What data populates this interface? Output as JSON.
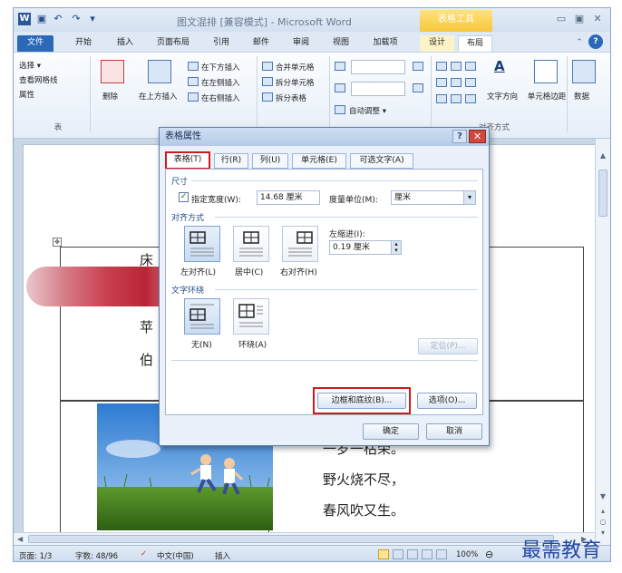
{
  "title_bar": {
    "title": "图文混排 [兼容模式] - Microsoft Word",
    "context_tools": "表格工具",
    "word_icon": "W",
    "qat_icons": [
      "save-icon",
      "undo-icon",
      "redo-icon",
      "customize-icon"
    ],
    "window_buttons": [
      "minimize-icon",
      "restore-icon",
      "close-icon"
    ]
  },
  "tabs": [
    "文件",
    "开始",
    "插入",
    "页面布局",
    "引用",
    "邮件",
    "审阅",
    "视图",
    "加载项",
    "设计",
    "布局"
  ],
  "ribbon": {
    "table_group": {
      "select": "选择 ▾",
      "gridlines": "查看网格线",
      "properties": "属性",
      "name": "表"
    },
    "delete": "删除",
    "insert_above": "在上方插入",
    "insert_below": "在下方插入",
    "insert_left": "在左侧插入",
    "insert_right": "在右侧插入",
    "merge_cells": "合并单元格",
    "split_cells": "拆分单元格",
    "split_table": "拆分表格",
    "autofit": "自动调整 ▾",
    "text_direction": "文字方向",
    "cell_margins": "单元格边距",
    "data": "数据",
    "align_group_name": "对齐方式"
  },
  "dialog": {
    "title": "表格属性",
    "help": "?",
    "close": "✕",
    "tabs": [
      "表格(T)",
      "行(R)",
      "列(U)",
      "单元格(E)",
      "可选文字(A)"
    ],
    "size_section": "尺寸",
    "preferred_width_label": "指定宽度(W):",
    "preferred_width_value": "14.68 厘米",
    "measure_label": "度量单位(M):",
    "measure_value": "厘米",
    "alignment_section": "对齐方式",
    "indent_label": "左缩进(I):",
    "indent_value": "0.19 厘米",
    "align_options": [
      "左对齐(L)",
      "居中(C)",
      "右对齐(H)"
    ],
    "wrap_section": "文字环绕",
    "wrap_options": [
      "无(N)",
      "环绕(A)"
    ],
    "position_button": "定位(P)...",
    "borders_button": "边框和底纹(B)...",
    "options_button": "选项(O)...",
    "ok": "确定",
    "cancel": "取消"
  },
  "document": {
    "poem_lines": [
      "一岁一枯荣。",
      "野火烧不尽，",
      "春风吹又生。"
    ],
    "fragments": [
      "床",
      "苹",
      "伯"
    ]
  },
  "status_bar": {
    "page": "页面: 1/3",
    "words": "字数: 48/96",
    "language": "中文(中国)",
    "mode": "插入",
    "zoom": "100%"
  },
  "watermark": "最需教育",
  "colors": {
    "highlight_red": "#d11a1a",
    "file_tab": "#2b68b8",
    "ribbon_bg": "#dfe9f5",
    "context_tab": "#f7c73c"
  }
}
